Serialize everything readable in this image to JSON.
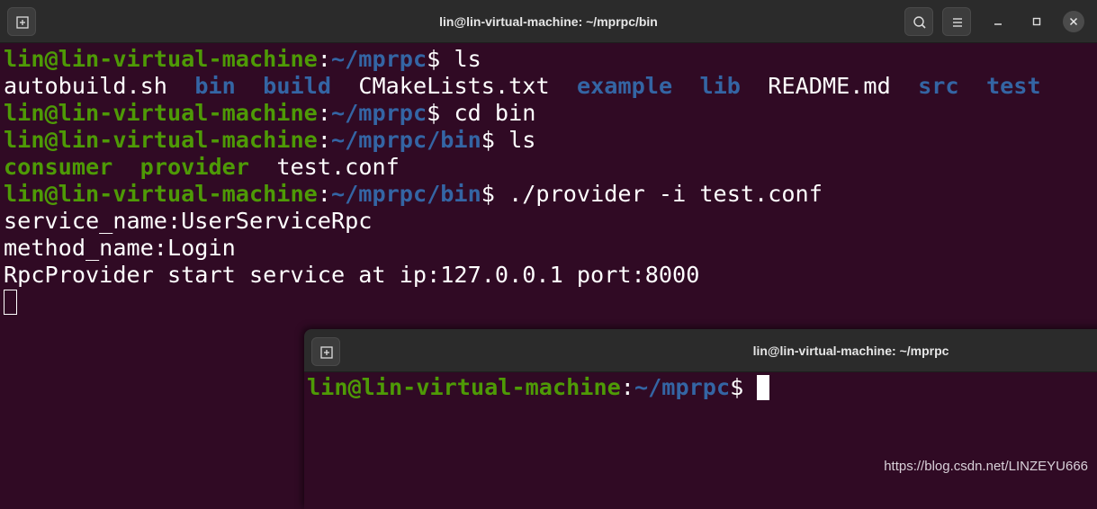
{
  "main_window": {
    "title": "lin@lin-virtual-machine: ~/mprpc/bin",
    "lines": [
      [
        {
          "t": "lin@lin-virtual-machine",
          "c": "g"
        },
        {
          "t": ":",
          "c": "w"
        },
        {
          "t": "~/mprpc",
          "c": "b"
        },
        {
          "t": "$ ls",
          "c": "w"
        }
      ],
      [
        {
          "t": "autobuild.sh  ",
          "c": "w"
        },
        {
          "t": "bin",
          "c": "b"
        },
        {
          "t": "  ",
          "c": "w"
        },
        {
          "t": "build",
          "c": "b"
        },
        {
          "t": "  CMakeLists.txt  ",
          "c": "w"
        },
        {
          "t": "example",
          "c": "b"
        },
        {
          "t": "  ",
          "c": "w"
        },
        {
          "t": "lib",
          "c": "b"
        },
        {
          "t": "  README.md  ",
          "c": "w"
        },
        {
          "t": "src",
          "c": "b"
        },
        {
          "t": "  ",
          "c": "w"
        },
        {
          "t": "test",
          "c": "b"
        }
      ],
      [
        {
          "t": "lin@lin-virtual-machine",
          "c": "g"
        },
        {
          "t": ":",
          "c": "w"
        },
        {
          "t": "~/mprpc",
          "c": "b"
        },
        {
          "t": "$ cd bin",
          "c": "w"
        }
      ],
      [
        {
          "t": "lin@lin-virtual-machine",
          "c": "g"
        },
        {
          "t": ":",
          "c": "w"
        },
        {
          "t": "~/mprpc/bin",
          "c": "b"
        },
        {
          "t": "$ ls",
          "c": "w"
        }
      ],
      [
        {
          "t": "consumer",
          "c": "g"
        },
        {
          "t": "  ",
          "c": "w"
        },
        {
          "t": "provider",
          "c": "g"
        },
        {
          "t": "  test.conf",
          "c": "w"
        }
      ],
      [
        {
          "t": "lin@lin-virtual-machine",
          "c": "g"
        },
        {
          "t": ":",
          "c": "w"
        },
        {
          "t": "~/mprpc/bin",
          "c": "b"
        },
        {
          "t": "$ ./provider -i test.conf",
          "c": "w"
        }
      ],
      [
        {
          "t": "service_name:UserServiceRpc",
          "c": "w"
        }
      ],
      [
        {
          "t": "method_name:Login",
          "c": "w"
        }
      ],
      [
        {
          "t": "RpcProvider start service at ip:127.0.0.1 port:8000",
          "c": "w"
        }
      ]
    ]
  },
  "second_window": {
    "title": "lin@lin-virtual-machine: ~/mprpc",
    "lines": [
      [
        {
          "t": "lin@lin-virtual-machine",
          "c": "g"
        },
        {
          "t": ":",
          "c": "w"
        },
        {
          "t": "~/mprpc",
          "c": "b"
        },
        {
          "t": "$ ",
          "c": "w"
        }
      ]
    ]
  },
  "watermark": "https://blog.csdn.net/LINZEYU666",
  "icons": {
    "new_tab": "new-tab-icon",
    "search": "search-icon",
    "menu": "hamburger-menu-icon",
    "minimize": "minimize-icon",
    "maximize": "maximize-icon",
    "close": "close-icon"
  },
  "colors": {
    "background": "#300a24",
    "prompt_user": "#4e9a06",
    "prompt_path": "#3465a4",
    "text": "#ffffff"
  }
}
